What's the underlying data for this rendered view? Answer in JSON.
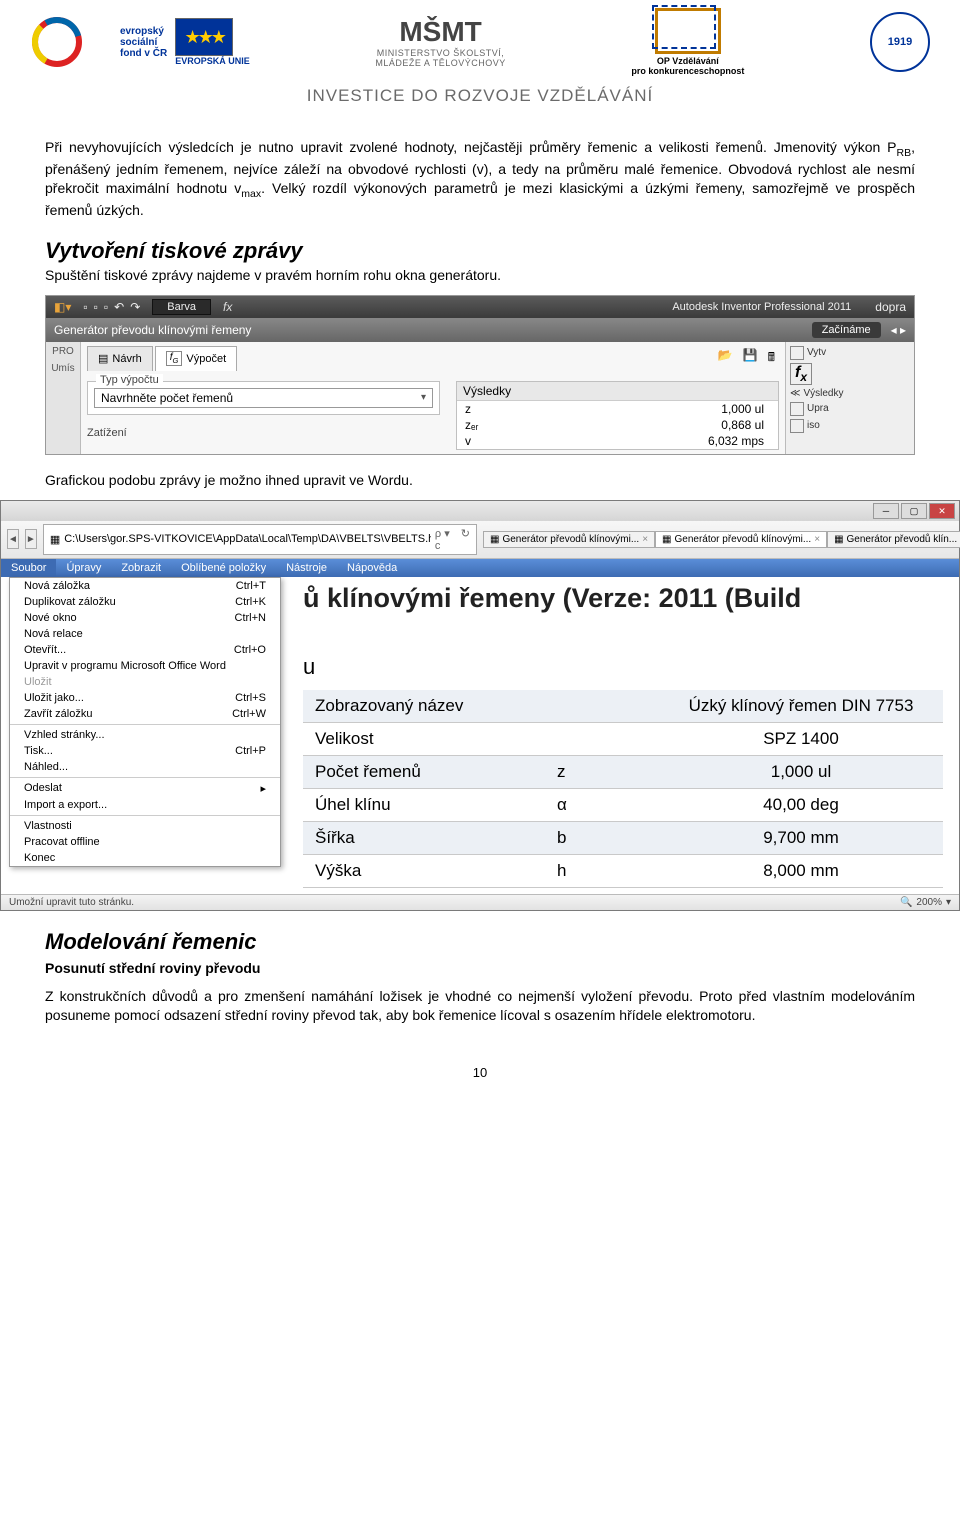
{
  "header": {
    "esf_line1": "evropský",
    "esf_line2": "sociální",
    "esf_line3": "fond v ČR",
    "eu_label": "EVROPSKÁ UNIE",
    "msmt_line1": "MINISTERSTVO ŠKOLSTVÍ,",
    "msmt_line2": "MLÁDEŽE A TĚLOVÝCHOVY",
    "op_line1": "OP Vzdělávání",
    "op_line2": "pro konkurenceschopnost",
    "gear_year": "1919",
    "tagline": "INVESTICE DO ROZVOJE VZDĚLÁVÁNÍ"
  },
  "text": {
    "p1a": "Při nevyhovujících výsledcích je nutno upravit zvolené hodnoty, nejčastěji průměry řemenic a velikosti řemenů. Jmenovitý výkon P",
    "p1sub": "RB",
    "p1b": ", přenášený jedním řemenem, nejvíce záleží na obvodové rychlosti (v), a tedy na průměru malé řemenice. Obvodová rychlost ale nesmí překročit maximální hodnotu v",
    "p1sub2": "max",
    "p1c": ". Velký rozdíl výkonových parametrů je mezi klasickými a úzkými řemeny, samozřejmě ve prospěch řemenů úzkých.",
    "h2_report": "Vytvoření tiskové zprávy",
    "p2": "Spuštění tiskové zprávy najdeme v pravém horním rohu okna generátoru.",
    "p3": "Grafickou podobu zprávy je možno ihned upravit ve Wordu.",
    "h2_model": "Modelování řemenic",
    "sub_model": "Posunutí střední roviny převodu",
    "p4": "Z konstrukčních důvodů a pro zmenšení namáhání ložisek je vhodné co nejmenší vyložení převodu. Proto před vlastním modelováním posuneme pomocí odsazení střední roviny převod tak, aby bok řemenice lícoval s osazením hřídele elektromotoru.",
    "pagenum": "10"
  },
  "inventor": {
    "barva": "Barva",
    "fx": "fx",
    "product": "Autodesk Inventor Professional 2011",
    "product_right": "dopra",
    "gen_title": "Generátor převodu klínovými řemeny",
    "ribbon_right": "Začínáme",
    "left_strip_pro": "PRO",
    "left_strip_umi": "Umís",
    "tab1": "Návrh",
    "tab2": "Výpočet",
    "legend": "Typ výpočtu",
    "dropdown": "Navrhněte počet řemenů",
    "zatizeni": "Zatížení",
    "results_hdr": "Výsledky",
    "results": [
      {
        "k": "z",
        "v": "1,000 ul"
      },
      {
        "k": "zₑᵣ",
        "v": "0,868 ul"
      },
      {
        "k": "v",
        "v": "6,032 mps"
      }
    ],
    "right_items": [
      "Vytv",
      "Výsledky",
      "Upra",
      "iso"
    ]
  },
  "ie": {
    "addrpath": "C:\\Users\\gor.SPS-VITKOVICE\\AppData\\Local\\Temp\\DA\\VBELTS\\VBELTS.htm",
    "search_sym": "ρ ▾ c",
    "tabs": [
      "Generátor převodů klínovými...",
      "Generátor převodů klínovými...",
      "Generátor převodů klín..."
    ],
    "menubar": [
      "Soubor",
      "Úpravy",
      "Zobrazit",
      "Oblíbené položky",
      "Nástroje",
      "Nápověda"
    ],
    "menu": [
      {
        "t": "Nová záložka",
        "k": "Ctrl+T"
      },
      {
        "t": "Duplikovat záložku",
        "k": "Ctrl+K"
      },
      {
        "t": "Nové okno",
        "k": "Ctrl+N"
      },
      {
        "t": "Nová relace",
        "k": ""
      },
      {
        "t": "Otevřít...",
        "k": "Ctrl+O"
      },
      {
        "t": "Upravit v programu Microsoft Office Word",
        "k": ""
      },
      {
        "t": "Uložit",
        "k": "",
        "dis": true
      },
      {
        "t": "Uložit jako...",
        "k": "Ctrl+S"
      },
      {
        "t": "Zavřít záložku",
        "k": "Ctrl+W"
      },
      {
        "sep": true
      },
      {
        "t": "Vzhled stránky...",
        "k": ""
      },
      {
        "t": "Tisk...",
        "k": "Ctrl+P"
      },
      {
        "t": "Náhled...",
        "k": ""
      },
      {
        "sep": true
      },
      {
        "t": "Odeslat",
        "k": "▸"
      },
      {
        "t": "Import a export...",
        "k": ""
      },
      {
        "sep": true
      },
      {
        "t": "Vlastnosti",
        "k": ""
      },
      {
        "t": "Pracovat offline",
        "k": ""
      },
      {
        "t": "Konec",
        "k": ""
      }
    ],
    "big_title": "ů klínovými řemeny (Verze: 2011 (Build",
    "caption_u": "u",
    "table": [
      {
        "n": "Zobrazovaný název",
        "s": "",
        "v": "Úzký klínový řemen DIN 7753"
      },
      {
        "n": "Velikost",
        "s": "",
        "v": "SPZ 1400"
      },
      {
        "n": "Počet řemenů",
        "s": "z",
        "v": "1,000 ul"
      },
      {
        "n": "Úhel klínu",
        "s": "α",
        "v": "40,00 deg"
      },
      {
        "n": "Šířka",
        "s": "b",
        "v": "9,700 mm"
      },
      {
        "n": "Výška",
        "s": "h",
        "v": "8,000 mm"
      }
    ],
    "status_left": "Umožní upravit tuto stránku.",
    "zoom": "200%"
  }
}
